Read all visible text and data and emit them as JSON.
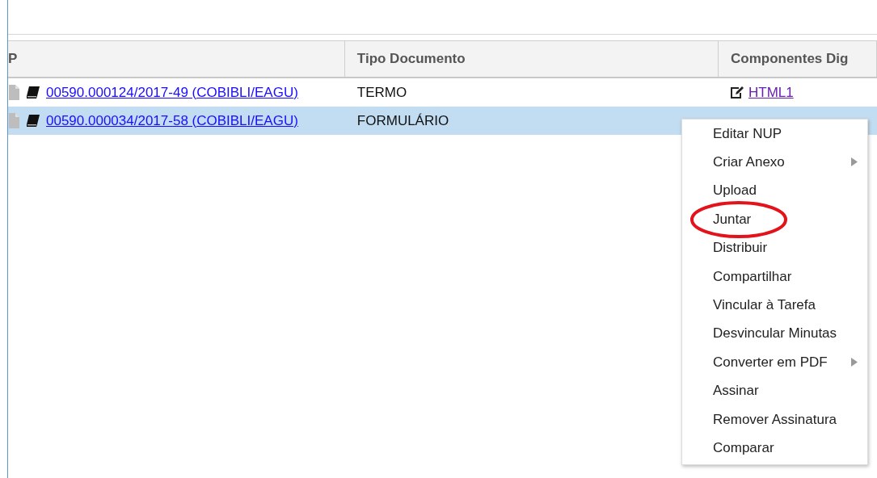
{
  "table": {
    "columns": [
      {
        "label": "P"
      },
      {
        "label": "Tipo Documento"
      },
      {
        "label": "Componentes Dig"
      }
    ],
    "rows": [
      {
        "selected": false,
        "nup": "00590.000124/2017-49 (COBIBLI/EAGU)",
        "tipo": "TERMO",
        "component": "HTML1"
      },
      {
        "selected": true,
        "nup": "00590.000034/2017-58 (COBIBLI/EAGU)",
        "tipo": "FORMULÁRIO"
      }
    ]
  },
  "context_menu": {
    "items": [
      {
        "label": "Editar NUP",
        "has_submenu": false,
        "circled": false
      },
      {
        "label": "Criar Anexo",
        "has_submenu": true,
        "circled": false
      },
      {
        "label": "Upload",
        "has_submenu": false,
        "circled": false
      },
      {
        "label": "Juntar",
        "has_submenu": false,
        "circled": true
      },
      {
        "label": "Distribuir",
        "has_submenu": false,
        "circled": false
      },
      {
        "label": "Compartilhar",
        "has_submenu": false,
        "circled": false
      },
      {
        "label": "Vincular à Tarefa",
        "has_submenu": false,
        "circled": false
      },
      {
        "label": "Desvincular Minutas",
        "has_submenu": false,
        "circled": false
      },
      {
        "label": "Converter em PDF",
        "has_submenu": true,
        "circled": false
      },
      {
        "label": "Assinar",
        "has_submenu": false,
        "circled": false
      },
      {
        "label": "Remover Assinatura",
        "has_submenu": false,
        "circled": false
      },
      {
        "label": "Comparar",
        "has_submenu": false,
        "circled": false
      }
    ]
  }
}
